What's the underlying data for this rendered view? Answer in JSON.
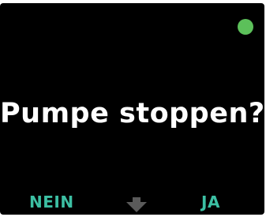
{
  "screen": {
    "question": "Pumpe stoppen?",
    "status_icon": "status-dot-icon",
    "status_color": "#5cc05a"
  },
  "softkeys": {
    "left_label": "NEIN",
    "right_label": "JA",
    "middle_icon": "down-arrow-icon",
    "label_color": "#3cbfa3"
  }
}
